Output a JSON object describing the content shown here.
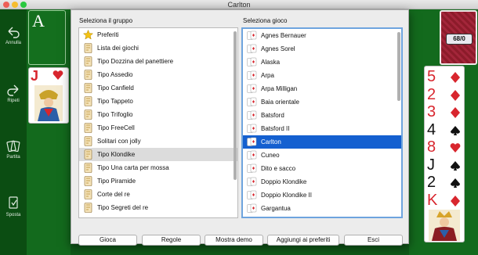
{
  "window": {
    "title": "Carlton"
  },
  "toolbar": {
    "undo_label": "Annulla",
    "redo_label": "Ripeti",
    "game_label": "Partita",
    "move_label": "Sposta"
  },
  "board": {
    "foundation_rank": "A",
    "deck_count": "68/0",
    "left_card": {
      "rank": "J",
      "suit": "heart"
    },
    "right_column": [
      {
        "rank": "5",
        "suit": "diamond",
        "color": "#d8262e"
      },
      {
        "rank": "2",
        "suit": "diamond",
        "color": "#d8262e"
      },
      {
        "rank": "3",
        "suit": "diamond",
        "color": "#d8262e"
      },
      {
        "rank": "4",
        "suit": "spade",
        "color": "#111111"
      },
      {
        "rank": "8",
        "suit": "heart",
        "color": "#d8262e"
      },
      {
        "rank": "J",
        "suit": "spade",
        "color": "#111111"
      },
      {
        "rank": "2",
        "suit": "spade",
        "color": "#111111"
      },
      {
        "rank": "K",
        "suit": "diamond",
        "color": "#d8262e"
      }
    ]
  },
  "dialog": {
    "group_label": "Seleziona il gruppo",
    "game_label": "Seleziona gioco",
    "groups": [
      {
        "label": "Preferiti",
        "icon": "star-icon"
      },
      {
        "label": "Lista dei giochi",
        "icon": "card-icon"
      },
      {
        "label": "Tipo Dozzina del panettiere",
        "icon": "card-icon"
      },
      {
        "label": "Tipo Assedio",
        "icon": "card-icon"
      },
      {
        "label": "Tipo Canfield",
        "icon": "card-icon"
      },
      {
        "label": "Tipo Tappeto",
        "icon": "card-icon"
      },
      {
        "label": "Tipo Trifoglio",
        "icon": "card-icon"
      },
      {
        "label": "Tipo FreeCell",
        "icon": "card-icon"
      },
      {
        "label": "Solitari con jolly",
        "icon": "card-icon"
      },
      {
        "label": "Tipo Klondike",
        "icon": "card-icon",
        "highlighted": true
      },
      {
        "label": "Tipo Una carta per mossa",
        "icon": "card-icon"
      },
      {
        "label": "Tipo Piramide",
        "icon": "card-icon"
      },
      {
        "label": "Corte del re",
        "icon": "card-icon"
      },
      {
        "label": "Tipo Segreti del re",
        "icon": "card-icon"
      }
    ],
    "games": [
      {
        "label": "Agnes Bernauer"
      },
      {
        "label": "Agnes Sorel"
      },
      {
        "label": "Alaska"
      },
      {
        "label": "Arpa"
      },
      {
        "label": "Arpa Milligan"
      },
      {
        "label": "Baia orientale"
      },
      {
        "label": "Batsford"
      },
      {
        "label": "Batsford II"
      },
      {
        "label": "Carlton",
        "selected": true
      },
      {
        "label": "Cuneo"
      },
      {
        "label": "Dito e sacco"
      },
      {
        "label": "Doppio Klondike"
      },
      {
        "label": "Doppio Klondike II"
      },
      {
        "label": "Gargantua"
      }
    ],
    "buttons": {
      "play": "Gioca",
      "rules": "Regole",
      "demo": "Mostra demo",
      "add_favorite": "Aggiungi ai preferiti",
      "exit": "Esci"
    }
  },
  "colors": {
    "selection": "#1460d0",
    "felt": "#136a1d",
    "card_red": "#d8262e"
  }
}
